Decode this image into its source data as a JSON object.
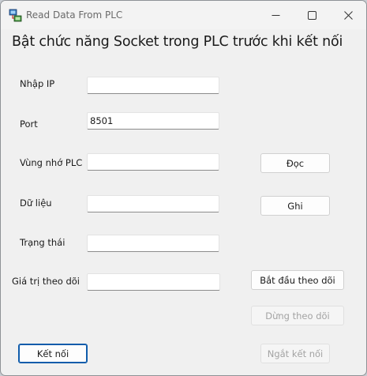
{
  "window": {
    "title": "Read Data From PLC",
    "icons": {
      "app": "plc-network-icon",
      "minimize": "minimize-icon",
      "maximize": "maximize-icon",
      "close": "close-icon"
    }
  },
  "heading": "Bật chức năng Socket trong PLC trước khi kết nối",
  "form": {
    "ip_label": "Nhập IP",
    "ip_value": "",
    "port_label": "Port",
    "port_value": "8501",
    "memory_label": "Vùng nhớ PLC",
    "memory_value": "",
    "data_label": "Dữ liệu",
    "data_value": "",
    "status_label": "Trạng thái",
    "status_value": "",
    "monitor_label": "Giá trị theo dõi",
    "monitor_value": ""
  },
  "buttons": {
    "read": "Đọc",
    "write": "Ghi",
    "start_monitor": "Bắt đầu theo dõi",
    "stop_monitor": "Dừng theo dõi",
    "connect": "Kết nối",
    "disconnect": "Ngắt kết nối"
  },
  "states": {
    "stop_monitor_enabled": false,
    "disconnect_enabled": false
  },
  "colors": {
    "accent": "#0f5cab",
    "disabled_text": "#a3a3a3"
  }
}
